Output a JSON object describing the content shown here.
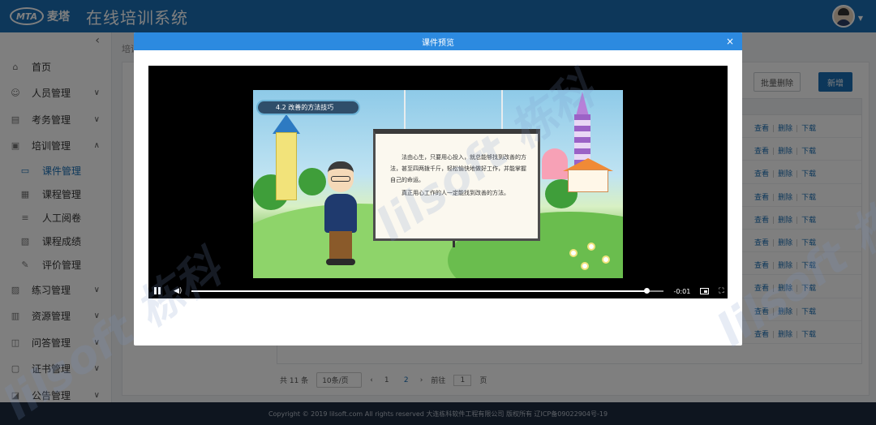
{
  "app": {
    "logo_text": "MTA",
    "logo_cn": "麦塔",
    "title": "在线培训系统"
  },
  "sidebar": {
    "items": [
      {
        "label": "首页",
        "icon": "home-icon"
      },
      {
        "label": "人员管理",
        "icon": "user-icon"
      },
      {
        "label": "考务管理",
        "icon": "exam-icon"
      },
      {
        "label": "培训管理",
        "icon": "training-icon"
      },
      {
        "label": "课件管理",
        "icon": "courseware-icon"
      },
      {
        "label": "课程管理",
        "icon": "course-icon"
      },
      {
        "label": "人工阅卷",
        "icon": "grading-icon"
      },
      {
        "label": "课程成绩",
        "icon": "score-icon"
      },
      {
        "label": "评价管理",
        "icon": "evaluation-icon"
      },
      {
        "label": "练习管理",
        "icon": "practice-icon"
      },
      {
        "label": "资源管理",
        "icon": "resource-icon"
      },
      {
        "label": "问答管理",
        "icon": "qa-icon"
      },
      {
        "label": "证书管理",
        "icon": "certificate-icon"
      },
      {
        "label": "公告管理",
        "icon": "announcement-icon"
      }
    ]
  },
  "content": {
    "breadcrumb": "培训",
    "batch_delete": "批量删除",
    "add_new": "新增",
    "row_actions": [
      "查看",
      "删除",
      "下载"
    ],
    "pagination": {
      "total": "共 11 条",
      "page_size": "10条/页",
      "pages": [
        "1",
        "2"
      ],
      "current_page": "2",
      "goto_label": "前往",
      "goto_value": "1",
      "page_suffix": "页"
    }
  },
  "modal": {
    "title": "课件预览",
    "close": "×",
    "slide": {
      "tag": "4.2  改善的方法技巧",
      "paragraph1": "法由心生，只要用心投入，就总能够找到改善的方法，甚至四两拨千斤，轻松愉快地做好工作，并能掌握自己的命运。",
      "paragraph2": "真正用心工作的人一定能找到改善的方法。"
    },
    "player": {
      "time": "-0:01",
      "progress": 0.964
    }
  },
  "footer": "Copyright © 2019 lilsoft.com All rights reserved 大连栋科软件工程有限公司 版权所有 辽ICP备09022904号-19",
  "watermark": "lilsoft 栋科"
}
